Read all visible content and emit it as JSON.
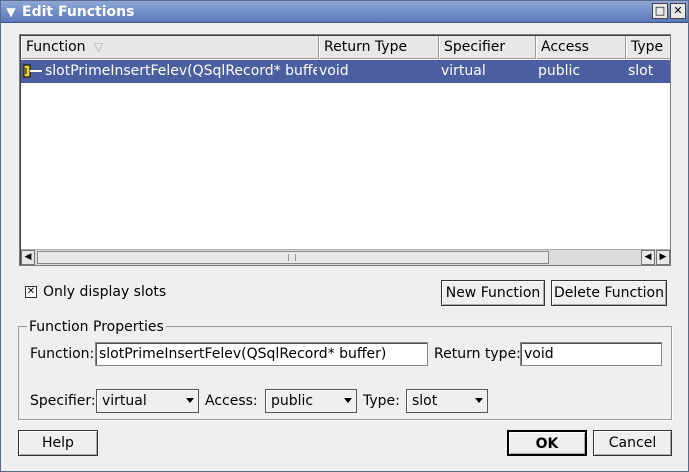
{
  "window": {
    "title": "Edit Functions"
  },
  "list": {
    "columns": [
      "Function",
      "Return Type",
      "Specifier",
      "Access",
      "Type"
    ],
    "rows": [
      {
        "function": "slotPrimeInsertFelev(QSqlRecord* buffer)",
        "return_type": "void",
        "specifier": "virtual",
        "access": "public",
        "type": "slot"
      }
    ]
  },
  "filter": {
    "only_slots_label": "Only display slots",
    "only_slots_checked": true
  },
  "actions": {
    "new_function": "New Function",
    "delete_function": "Delete Function"
  },
  "properties": {
    "group_title": "Function Properties",
    "function_label": "Function:",
    "function_value": "slotPrimeInsertFelev(QSqlRecord* buffer)",
    "return_type_label": "Return type:",
    "return_type_value": "void",
    "specifier_label": "Specifier:",
    "specifier_value": "virtual",
    "access_label": "Access:",
    "access_value": "public",
    "type_label": "Type:",
    "type_value": "slot"
  },
  "footer": {
    "help": "Help",
    "ok": "OK",
    "cancel": "Cancel"
  },
  "colors": {
    "selection": "#4b5fa0",
    "titlebar": "#5a78b8"
  }
}
